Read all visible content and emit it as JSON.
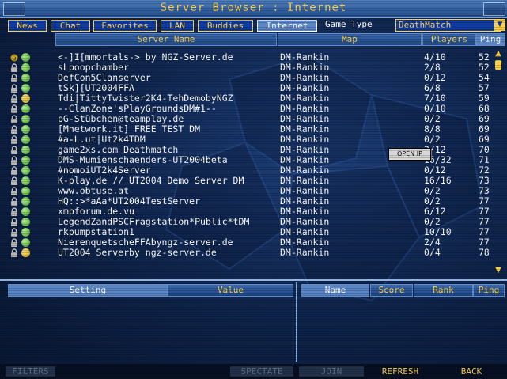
{
  "window": {
    "title": "Server Browser : Internet"
  },
  "tabs": [
    "News",
    "Chat",
    "Favorites",
    "LAN",
    "Buddies",
    "Internet"
  ],
  "active_tab": "Internet",
  "game_type": {
    "label": "Game Type",
    "value": "DeathMatch"
  },
  "columns": {
    "name": "Server Name",
    "map": "Map",
    "players": "Players",
    "ping": "Ping"
  },
  "servers": [
    {
      "name": "<-]I[mmortals-> by NGZ-Server.de",
      "map": "DM-Rankin",
      "players": "4/10",
      "ping": "52",
      "locked": false
    },
    {
      "name": "sLpoopchamber",
      "map": "DM-Rankin",
      "players": "2/8",
      "ping": "52",
      "locked": true
    },
    {
      "name": "DefCon5Clanserver",
      "map": "DM-Rankin",
      "players": "0/12",
      "ping": "54",
      "locked": true
    },
    {
      "name": "tSk][UT2004FFA",
      "map": "DM-Rankin",
      "players": "6/8",
      "ping": "57",
      "locked": true
    },
    {
      "name": "Tdi|TittyTwister2K4-TehDemobyNGZ",
      "map": "DM-Rankin",
      "players": "7/10",
      "ping": "59",
      "locked": true
    },
    {
      "name": "--ClanZone'sPlayGroundsDM#1--",
      "map": "DM-Rankin",
      "players": "0/10",
      "ping": "68",
      "locked": true
    },
    {
      "name": "pG-Stübchen@teamplay.de",
      "map": "DM-Rankin",
      "players": "0/2",
      "ping": "69",
      "locked": true
    },
    {
      "name": "[Mnetwork.it] FREE TEST DM",
      "map": "DM-Rankin",
      "players": "8/8",
      "ping": "69",
      "locked": true
    },
    {
      "name": "#a-L.ut|Ut2k4TDM",
      "map": "DM-Rankin",
      "players": "0/2",
      "ping": "69",
      "locked": true
    },
    {
      "name": "game2xs.com Deathmatch",
      "map": "DM-Rankin",
      "players": "2/12",
      "ping": "70",
      "locked": true
    },
    {
      "name": "DMS-Mumienschaenders-UT2004beta",
      "map": "DM-Rankin",
      "players": "16/32",
      "ping": "71",
      "locked": true
    },
    {
      "name": "#nomoiUT2k4Server",
      "map": "DM-Rankin",
      "players": "0/12",
      "ping": "72",
      "locked": true
    },
    {
      "name": "K-play.de // UT2004 Demo Server DM",
      "map": "DM-Rankin",
      "players": "16/16",
      "ping": "73",
      "locked": true
    },
    {
      "name": "www.obtuse.at",
      "map": "DM-Rankin",
      "players": "0/2",
      "ping": "73",
      "locked": true
    },
    {
      "name": "HQ::>*aAa*UT2004TestServer",
      "map": "DM-Rankin",
      "players": "0/2",
      "ping": "77",
      "locked": true
    },
    {
      "name": "xmpforum.de.vu",
      "map": "DM-Rankin",
      "players": "6/12",
      "ping": "77",
      "locked": true
    },
    {
      "name": "LegendZandPSCFragstation*Public*tDM",
      "map": "DM-Rankin",
      "players": "0/2",
      "ping": "77",
      "locked": true
    },
    {
      "name": "rkpumpstation1",
      "map": "DM-Rankin",
      "players": "10/10",
      "ping": "77",
      "locked": true
    },
    {
      "name": "NierenquetscheFFAbyngz-server.de",
      "map": "DM-Rankin",
      "players": "2/4",
      "ping": "77",
      "locked": true
    },
    {
      "name": "UT2004 Serverby ngz-server.de",
      "map": "DM-Rankin",
      "players": "0/4",
      "ping": "78",
      "locked": true
    }
  ],
  "context_menu": {
    "open_ip": "OPEN IP"
  },
  "rules_panel": {
    "setting": "Setting",
    "value": "Value"
  },
  "players_panel": {
    "name": "Name",
    "score": "Score",
    "rank": "Rank",
    "ping": "Ping"
  },
  "bottom_bar": {
    "filters": "FILTERS",
    "spectate": "SPECTATE",
    "join": "JOIN",
    "refresh": "REFRESH",
    "back": "BACK"
  },
  "colors": {
    "accent": "#ffd24a",
    "tab_bg": "#0f3aa0",
    "active": "#5a86c8",
    "text": "#ffffff"
  }
}
